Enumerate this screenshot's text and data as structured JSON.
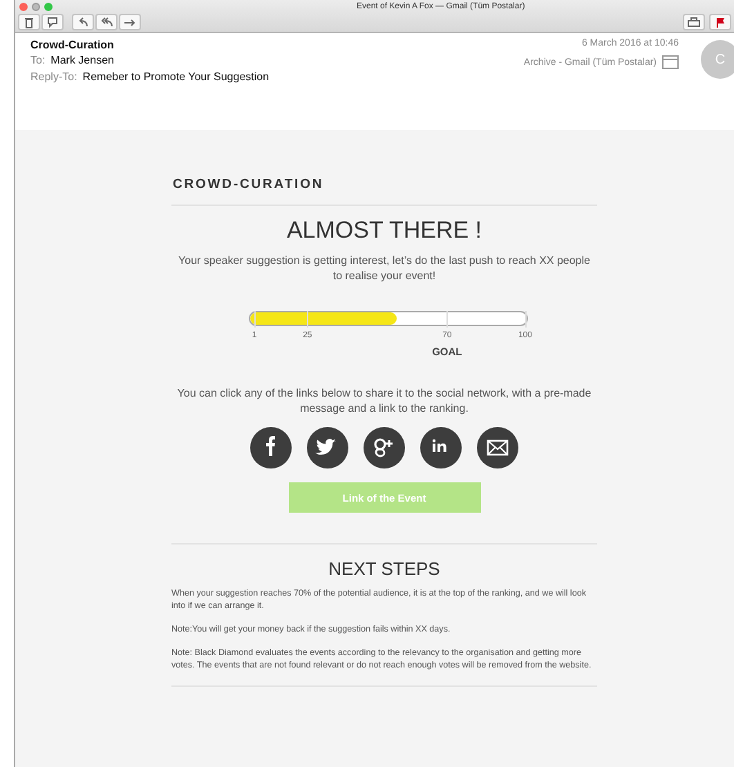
{
  "window": {
    "title": "Event of Kevin A Fox — Gmail (Tüm Postalar)"
  },
  "email": {
    "from": "Crowd-Curation",
    "to_label": "To:",
    "to": "Mark Jensen",
    "reply_to_label": "Reply-To:",
    "reply_to": "Remeber to Promote Your Suggestion",
    "date": "6 March 2016 at 10:46",
    "mailbox": "Archive - Gmail (Tüm Postalar)",
    "avatar": "C"
  },
  "body": {
    "brand": "CROWD-CURATION",
    "heading": "ALMOST THERE !",
    "intro": "Your speaker suggestion is getting interest, let’s do the last push to reach XX people to realise your event!",
    "progress": {
      "level": 0.53,
      "ticks": [
        "1",
        "25",
        "70",
        "100"
      ],
      "goal_label": "GOAL"
    },
    "share_text": "You can click any of the links below to share it to the social network, with a pre-made message and a link to the ranking.",
    "social": [
      {
        "kind": "facebook"
      },
      {
        "kind": "twitter"
      },
      {
        "kind": "googleplus"
      },
      {
        "kind": "linkedin"
      },
      {
        "kind": "email"
      }
    ],
    "button": "Link of the Event",
    "next_heading": "NEXT STEPS",
    "paragraphs": [
      "When your suggestion reaches 70% of the potential audience, it is at the top of the ranking, and we will look into if we can arrange it.",
      "Note:You will get your money back if the suggestion fails within XX days.",
      "Note: Black Diamond evaluates the events according to the relevancy to the organisation and getting more votes. The events that are not found relevant or do not reach enough votes will be removed from the website."
    ]
  }
}
